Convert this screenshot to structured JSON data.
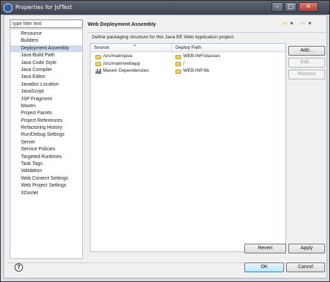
{
  "window": {
    "title": "Properties for JsfTest",
    "controls": {
      "minimize": "–",
      "maximize": "□",
      "close": "✕"
    }
  },
  "filter": {
    "placeholder": "type filter text",
    "value": "type filter text"
  },
  "nav": {
    "items": [
      {
        "label": "Resource",
        "expandable": true
      },
      {
        "label": "Builders"
      },
      {
        "label": "Deployment Assembly",
        "selected": true
      },
      {
        "label": "Java Build Path"
      },
      {
        "label": "Java Code Style",
        "expandable": true
      },
      {
        "label": "Java Compiler",
        "expandable": true
      },
      {
        "label": "Java Editor",
        "expandable": true
      },
      {
        "label": "Javadoc Location"
      },
      {
        "label": "JavaScript",
        "expandable": true
      },
      {
        "label": "JSP Fragment"
      },
      {
        "label": "Maven",
        "expandable": true
      },
      {
        "label": "Project Facets"
      },
      {
        "label": "Project References"
      },
      {
        "label": "Refactoring History"
      },
      {
        "label": "Run/Debug Settings"
      },
      {
        "label": "Server"
      },
      {
        "label": "Service Policies"
      },
      {
        "label": "Targeted Runtimes"
      },
      {
        "label": "Task Tags"
      },
      {
        "label": "Validation",
        "expandable": true
      },
      {
        "label": "Web Content Settings"
      },
      {
        "label": "Web Project Settings"
      },
      {
        "label": "XDoclet",
        "expandable": true
      }
    ]
  },
  "page": {
    "title": "Web Deployment Assembly",
    "description": "Define packaging structure for this Java EE Web Application project."
  },
  "table": {
    "columns": [
      "Source",
      "Deploy Path"
    ],
    "rows": [
      {
        "source": "/src/main/java",
        "deploy": "WEB-INF/classes",
        "icon": "folder-icon"
      },
      {
        "source": "/src/main/webapp",
        "deploy": "/",
        "icon": "folder-icon"
      },
      {
        "source": "Maven Dependencies",
        "deploy": "WEB-INF/lib",
        "icon": "library-icon"
      }
    ]
  },
  "buttons": {
    "add": "Add...",
    "edit": "Edit...",
    "remove": "Remove",
    "revert": "Revert",
    "apply": "Apply",
    "ok": "OK",
    "cancel": "Cancel"
  },
  "icons": {
    "back": "back-arrow-icon",
    "forward": "forward-arrow-icon",
    "help": "help-icon"
  },
  "colors": {
    "selection": "#cfdcef",
    "folder": "#f0cf63",
    "default_button": "#bee6fd"
  }
}
